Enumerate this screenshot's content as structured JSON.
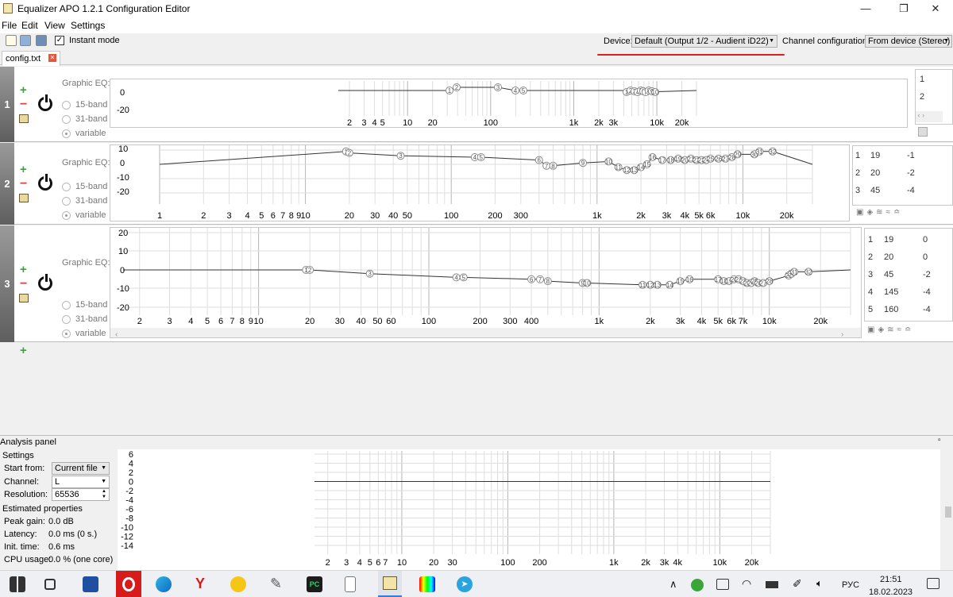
{
  "window": {
    "title": "Equalizer APO 1.2.1 Configuration Editor",
    "minimize": "—",
    "maximize": "❐",
    "close": "✕"
  },
  "menu": [
    "File",
    "Edit",
    "View",
    "Settings"
  ],
  "toolbar": {
    "instant_mode_label": "Instant mode",
    "instant_mode_checked": "✓",
    "device_label": "Device:",
    "device_value": "Default (Output 1/2 - Audient iD22)",
    "channel_label": "Channel configuration:",
    "channel_value": "From device (Stereo)"
  },
  "tab": {
    "label": "config.txt",
    "close": "✕"
  },
  "filter_common": {
    "type_label": "Graphic EQ:",
    "options": [
      "15-band",
      "31-band",
      "variable"
    ],
    "selected_option": "variable"
  },
  "filters": [
    {
      "number": "1",
      "y_ticks": [
        "0",
        "-20"
      ],
      "freq_ticks": [
        "2",
        "3",
        "4",
        "5",
        "10",
        "20",
        "100",
        "1k",
        "2k",
        "3k",
        "10k",
        "20k"
      ],
      "node_labels": [
        "1",
        "2",
        "3",
        "4",
        "5",
        "1",
        "2",
        "3",
        "4",
        "5",
        "6",
        "7",
        "8",
        "9",
        "10"
      ],
      "table_rows": [
        [
          "1"
        ],
        [
          "2"
        ]
      ]
    },
    {
      "number": "2",
      "y_ticks": [
        "10",
        "0",
        "-10",
        "-20"
      ],
      "freq_ticks": [
        "1",
        "2",
        "3",
        "4",
        "5",
        "6",
        "7",
        "8",
        "9",
        "10",
        "20",
        "30",
        "40",
        "50",
        "100",
        "200",
        "300",
        "1k",
        "2k",
        "3k",
        "4k",
        "5k",
        "6k",
        "10k",
        "20k"
      ],
      "node_labels": [
        "1",
        "2",
        "3",
        "4",
        "5",
        "6",
        "7",
        "8",
        "9",
        "10",
        "11",
        "12",
        "13",
        "14",
        "15",
        "16",
        "17",
        "18",
        "19",
        "20",
        "21",
        "22",
        "23",
        "24",
        "25",
        "26",
        "27",
        "28",
        "29",
        "30",
        "31",
        "32"
      ],
      "table_rows": [
        [
          "1",
          "19",
          "-1"
        ],
        [
          "2",
          "20",
          "-2"
        ],
        [
          "3",
          "45",
          "-4"
        ]
      ]
    },
    {
      "number": "3",
      "y_ticks": [
        "20",
        "10",
        "0",
        "-10",
        "-20"
      ],
      "freq_ticks": [
        "2",
        "3",
        "4",
        "5",
        "6",
        "7",
        "8",
        "9",
        "10",
        "20",
        "30",
        "40",
        "50",
        "60",
        "100",
        "200",
        "300",
        "400",
        "1k",
        "2k",
        "3k",
        "4k",
        "5k",
        "6k",
        "7k",
        "10k",
        "20k"
      ],
      "node_labels": [
        "1",
        "2",
        "3",
        "4",
        "5",
        "6",
        "7",
        "8",
        "9",
        "10",
        "11",
        "12",
        "13",
        "14",
        "15",
        "16",
        "17",
        "18",
        "19",
        "20",
        "21",
        "22",
        "23",
        "24",
        "25",
        "26",
        "27",
        "28",
        "29",
        "30",
        "31",
        "32"
      ],
      "table_rows": [
        [
          "1",
          "19",
          "0"
        ],
        [
          "2",
          "20",
          "0"
        ],
        [
          "3",
          "45",
          "-2"
        ],
        [
          "4",
          "145",
          "-4"
        ],
        [
          "5",
          "160",
          "-4"
        ]
      ]
    }
  ],
  "analysis": {
    "panel_title": "Analysis panel",
    "settings_heading": "Settings",
    "start_from_label": "Start from:",
    "start_from_value": "Current file",
    "channel_label": "Channel:",
    "channel_value": "L",
    "resolution_label": "Resolution:",
    "resolution_value": "65536",
    "estimated_heading": "Estimated properties",
    "peak_gain_label": "Peak gain:",
    "peak_gain_value": "0.0 dB",
    "latency_label": "Latency:",
    "latency_value": "0.0 ms (0 s.)",
    "init_time_label": "Init. time:",
    "init_time_value": "0.6 ms",
    "cpu_label": "CPU usage:",
    "cpu_value": "0.0 % (one core)",
    "y_ticks": [
      "6",
      "4",
      "2",
      "0",
      "-2",
      "-4",
      "-6",
      "-8",
      "-10",
      "-12",
      "-14"
    ],
    "freq_ticks": [
      "2",
      "3",
      "4",
      "5",
      "6",
      "7",
      "10",
      "20",
      "30",
      "100",
      "200",
      "1k",
      "2k",
      "3k",
      "4k",
      "10k",
      "20k"
    ]
  },
  "taskbar": {
    "apps": [
      "windows-start",
      "task-view",
      "save-app",
      "opera",
      "edge",
      "yandex",
      "warning-app",
      "feather-app",
      "pycharm",
      "file",
      "notepad",
      "photo-app",
      "telegram"
    ],
    "lang": "РУС",
    "time": "21:51",
    "date": "18.02.2023"
  },
  "colors": {
    "accent_underline": "#e11d1d",
    "row_tab": "#707070"
  }
}
